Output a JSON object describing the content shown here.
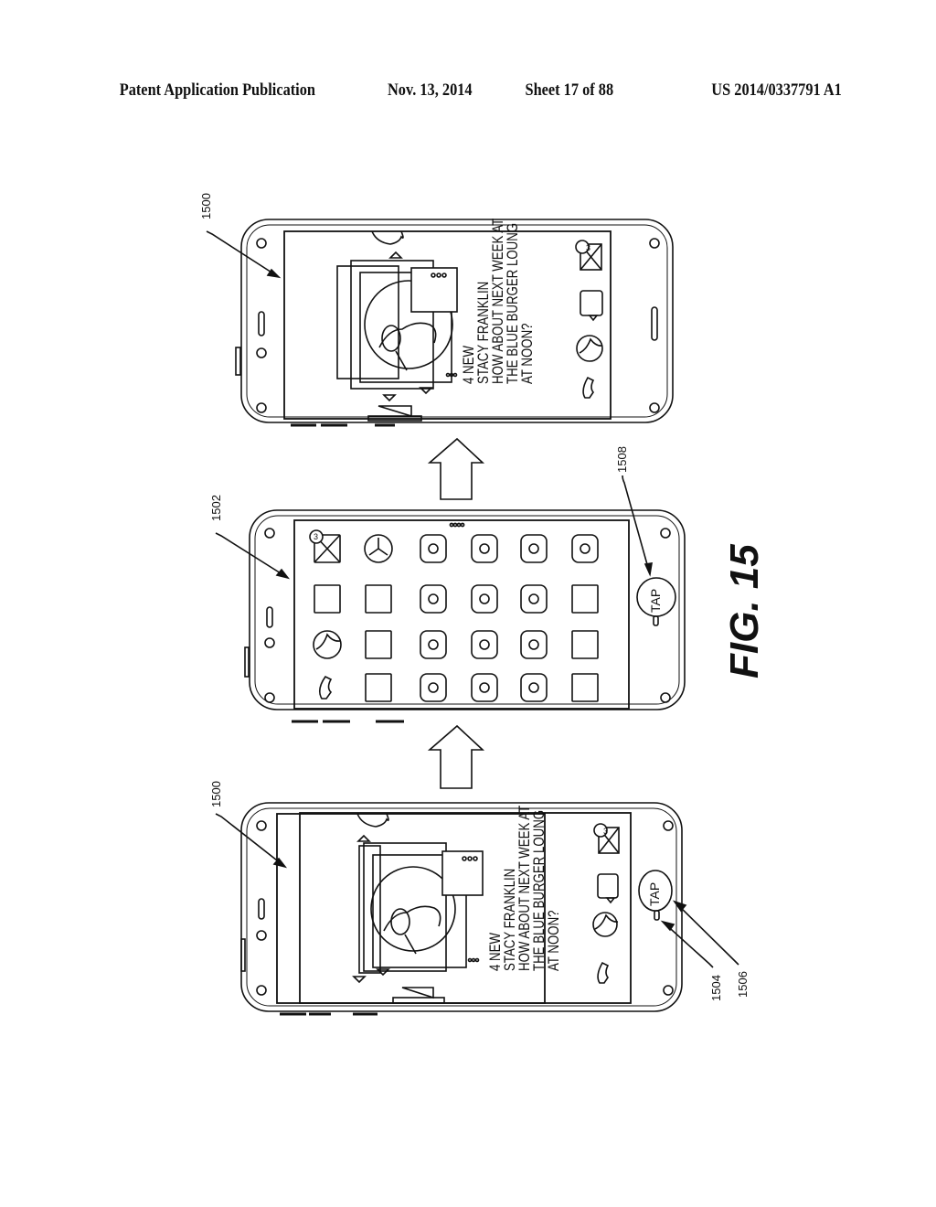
{
  "header": {
    "publication": "Patent Application Publication",
    "date": "Nov. 13, 2014",
    "sheet": "Sheet 17 of 88",
    "patent_number": "US 2014/0337791 A1"
  },
  "figure_label": "FIG. 15",
  "phones": [
    {
      "ref": "1500",
      "view": "lock-screen-after-tap",
      "message_lines": [
        "4 NEW",
        "STACY FRANKLIN",
        "HOW ABOUT NEXT WEEK AT",
        "THE BLUE BURGER LOUNG",
        "AT NOON?"
      ],
      "mail_badge": "3",
      "dock_icons": [
        "mail-icon",
        "message-icon",
        "browser-icon",
        "phone-icon"
      ]
    },
    {
      "ref": "1502",
      "view": "app-grid",
      "page_dots": 4,
      "tap_label": "TAP",
      "tap_ref": "1508",
      "mail_badge": "3",
      "grid_rows": [
        [
          "mail-icon",
          "clock-icon",
          "app-triangle-icon",
          "app-leaf-icon",
          "calculator-icon",
          "app-globe-icon"
        ],
        [
          "message-icon",
          "photo-frame-icon",
          "app-cart-icon",
          "app-book-icon",
          "app-shop-icon",
          "contacts-icon"
        ],
        [
          "browser-icon",
          "document-icon",
          "app-music-icon",
          "app-tools-icon",
          "app-window-icon",
          "folder-icon"
        ],
        [
          "phone-icon",
          "map-icon",
          "app-cube-icon",
          "app-bird-icon",
          "app-stack-icon",
          "cards-icon"
        ]
      ]
    },
    {
      "ref": "1500",
      "view": "lock-screen-before-tap",
      "message_lines": [
        "4 NEW",
        "STACY FRANKLIN",
        "HOW ABOUT NEXT WEEK AT",
        "THE BLUE BURGER LOUNG",
        "AT NOON?"
      ],
      "mail_badge": "3",
      "tap_label": "TAP",
      "tap_refs": [
        "1504",
        "1506"
      ],
      "dock_icons": [
        "mail-icon",
        "message-icon",
        "browser-icon",
        "phone-icon"
      ]
    }
  ]
}
